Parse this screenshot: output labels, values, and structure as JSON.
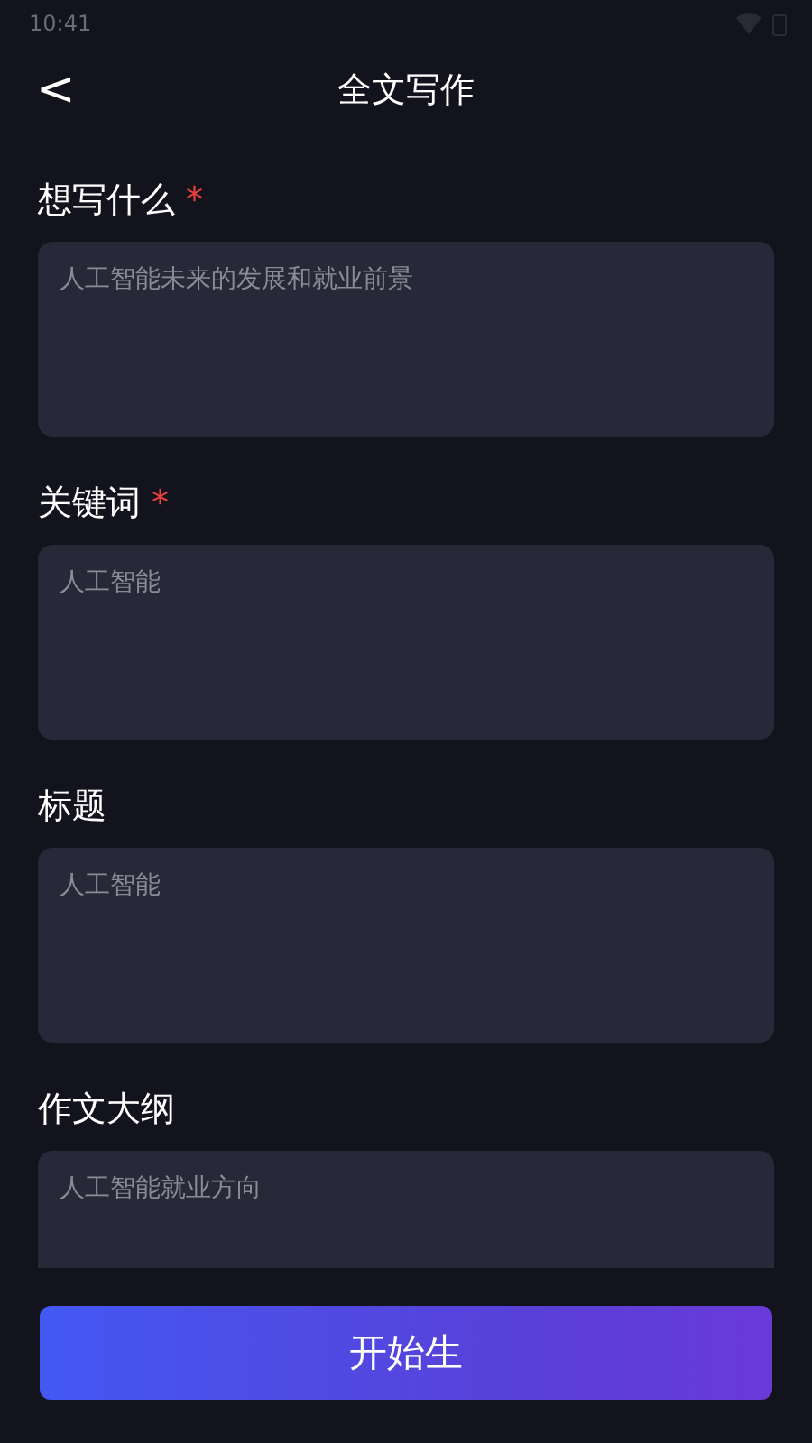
{
  "status_bar": {
    "time": "10:41"
  },
  "header": {
    "back": "<",
    "title": "全文写作"
  },
  "fields": [
    {
      "label": "想写什么",
      "required": true,
      "required_mark": "*",
      "placeholder": "人工智能未来的发展和就业前景"
    },
    {
      "label": "关键词",
      "required": true,
      "required_mark": "*",
      "placeholder": "人工智能"
    },
    {
      "label": "标题",
      "required": false,
      "placeholder": "人工智能"
    },
    {
      "label": "作文大纲",
      "required": false,
      "placeholder": "人工智能就业方向"
    }
  ],
  "submit": {
    "label": "开始生"
  }
}
